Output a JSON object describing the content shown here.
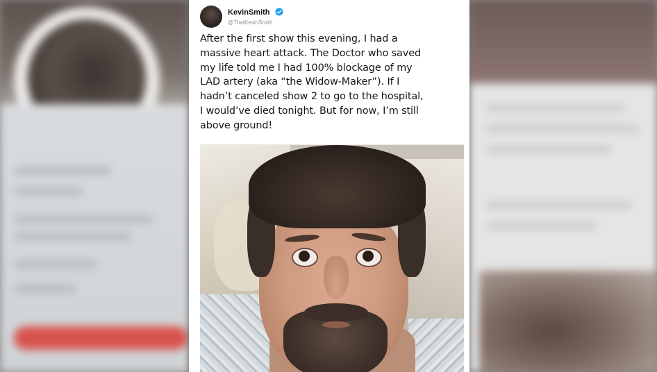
{
  "tweet": {
    "author_name": "KevinSmith",
    "author_handle": "@ThatKevinSmith",
    "verified": true,
    "text_lines": [
      "After the first show this evening, I had a",
      "massive heart attack. The Doctor who saved",
      "my life told me I had 100% blockage of my",
      "LAD artery (aka “the Widow-Maker”). If I",
      "hadn’t canceled show 2 to go to the hospital,",
      "I would’ve died tonight. But for now, I’m still",
      "above ground!"
    ],
    "media": {
      "icon": "selfie-photo"
    }
  },
  "colors": {
    "verified_blue": "#1da1f2",
    "text": "#14171a",
    "handle_gray": "#8a949c"
  }
}
